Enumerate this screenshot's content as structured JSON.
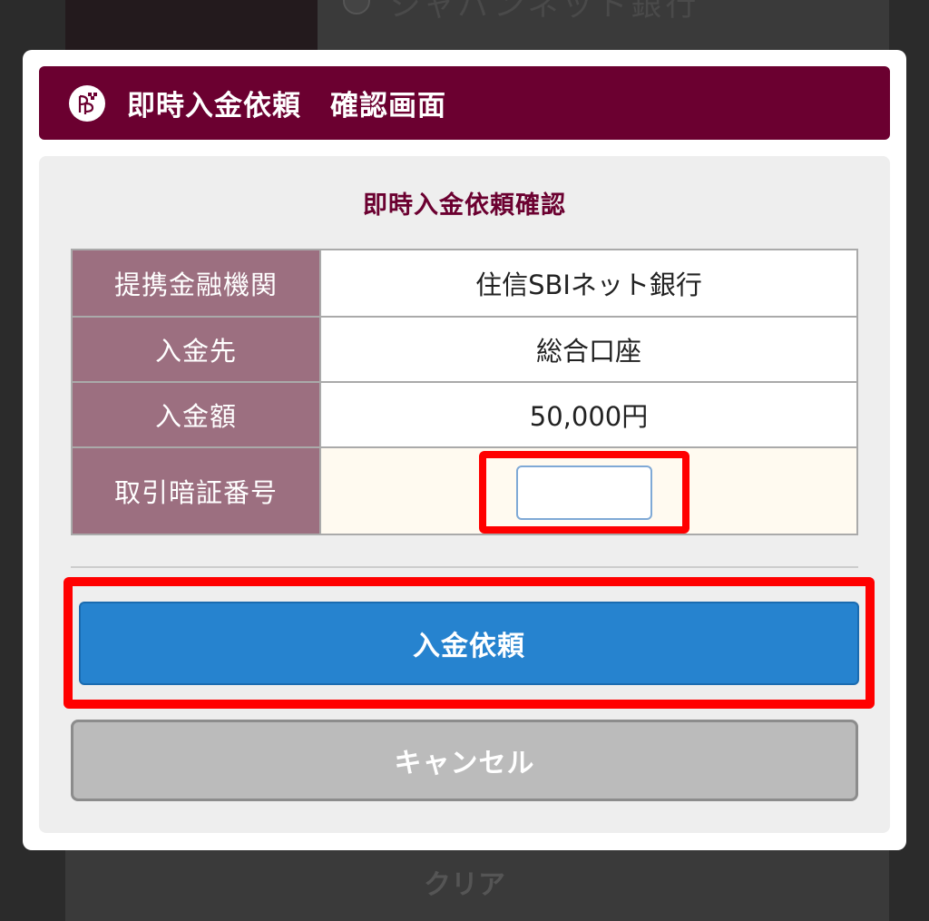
{
  "background": {
    "top_text": "ジャパンネット銀行",
    "clear_label": "クリア"
  },
  "dialog": {
    "title": "即時入金依頼　確認画面",
    "subtitle": "即時入金依頼確認",
    "rows": [
      {
        "label": "提携金融機関",
        "value": "住信SBIネット銀行"
      },
      {
        "label": "入金先",
        "value": "総合口座"
      },
      {
        "label": "入金額",
        "value": "50,000円"
      },
      {
        "label": "取引暗証番号",
        "value": ""
      }
    ],
    "submit_label": "入金依頼",
    "cancel_label": "キャンセル"
  },
  "colors": {
    "header": "#6b0030",
    "label_cell": "#9c6f80",
    "submit": "#2683cf",
    "cancel": "#bbbbbb",
    "highlight": "#ff0000"
  },
  "icons": {
    "logo": "brand-logo-icon"
  }
}
